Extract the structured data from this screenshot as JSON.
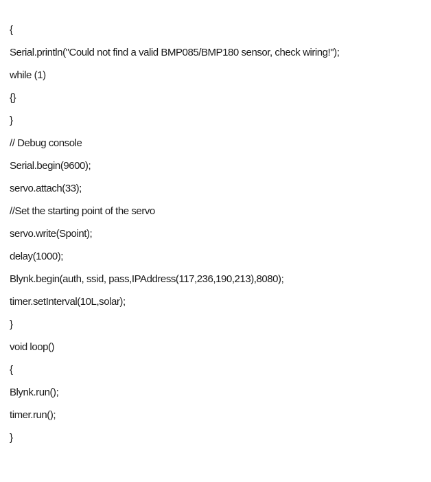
{
  "document": {
    "lines": [
      "{",
      "Serial.println(\"Could not find a valid BMP085/BMP180 sensor, check wiring!\");",
      "while (1)",
      "{}",
      "}",
      "// Debug console",
      "Serial.begin(9600);",
      "servo.attach(33);",
      "//Set the starting point of the servo",
      "servo.write(Spoint);",
      "delay(1000);",
      "Blynk.begin(auth, ssid, pass,IPAddress(117,236,190,213),8080);",
      "timer.setInterval(10L,solar);",
      "}",
      "void loop()",
      "{",
      "Blynk.run();",
      "timer.run();",
      "}"
    ]
  }
}
